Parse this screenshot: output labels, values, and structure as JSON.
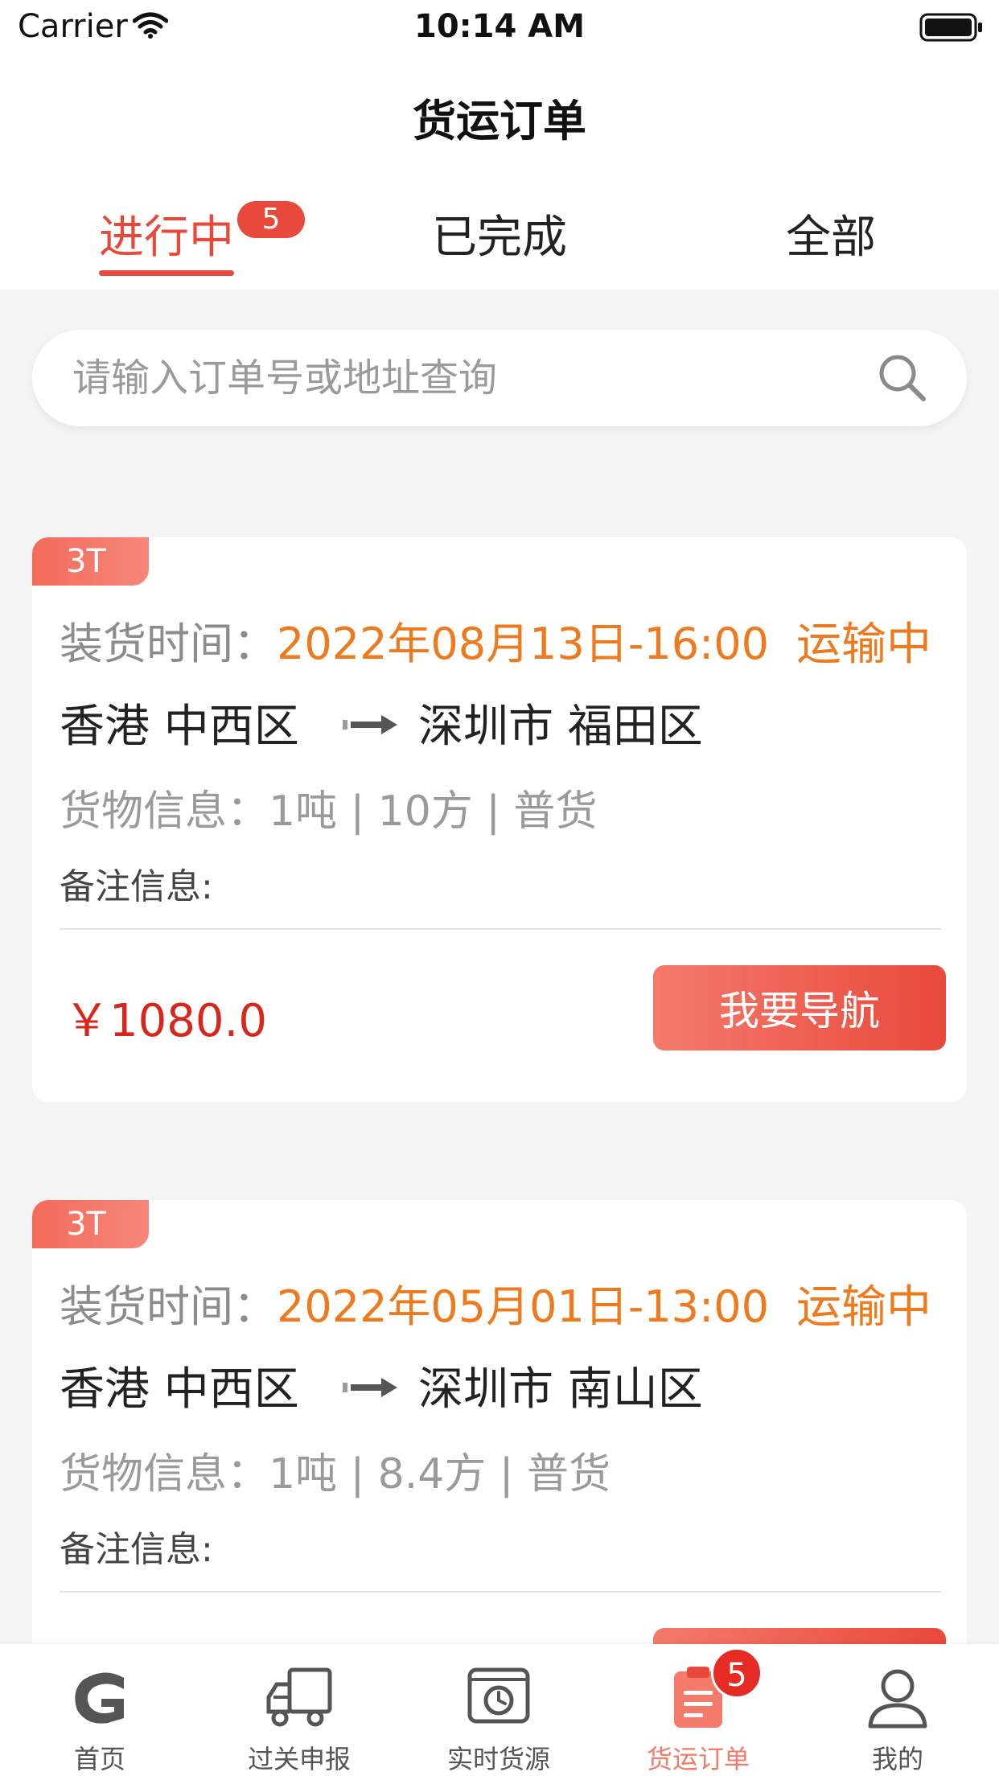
{
  "status_bar": {
    "carrier": "Carrier",
    "time": "10:14 AM"
  },
  "header": {
    "title": "货运订单"
  },
  "tabs": [
    {
      "label": "进行中",
      "badge": "5",
      "active": true
    },
    {
      "label": "已完成",
      "active": false
    },
    {
      "label": "全部",
      "active": false
    }
  ],
  "search": {
    "placeholder": "请输入订单号或地址查询"
  },
  "orders": [
    {
      "tag": "3T",
      "load_label": "装货时间：",
      "load_time": "2022年08月13日-16:00",
      "status": "运输中",
      "from": "香港 中西区",
      "to": "深圳市 福田区",
      "cargo": "货物信息：1吨 | 10方 | 普货",
      "remark": "备注信息:",
      "price": "￥1080.0",
      "button": "我要导航"
    },
    {
      "tag": "3T",
      "load_label": "装货时间：",
      "load_time": "2022年05月01日-13:00",
      "status": "运输中",
      "from": "香港 中西区",
      "to": "深圳市 南山区",
      "cargo": "货物信息：1吨 | 8.4方 | 普货",
      "remark": "备注信息:",
      "price": "",
      "button": ""
    }
  ],
  "tab_bar": [
    {
      "label": "首页",
      "icon": "home-logo-icon",
      "active": false
    },
    {
      "label": "过关申报",
      "icon": "truck-icon",
      "active": false
    },
    {
      "label": "实时货源",
      "icon": "clock-box-icon",
      "active": false
    },
    {
      "label": "货运订单",
      "icon": "clipboard-icon",
      "active": true,
      "badge": "5"
    },
    {
      "label": "我的",
      "icon": "user-icon",
      "active": false
    }
  ],
  "colors": {
    "accent": "#e8493b",
    "orange": "#ee7a1d",
    "price_red": "#d9261c"
  }
}
